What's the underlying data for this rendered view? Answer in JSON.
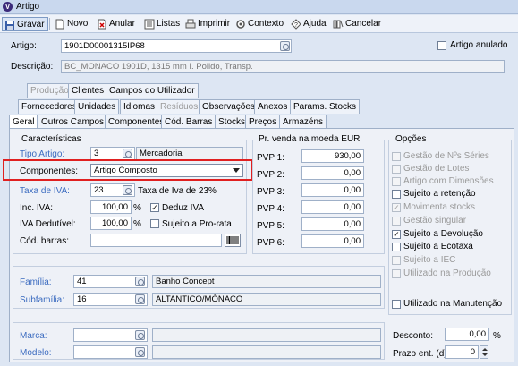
{
  "window": {
    "title": "Artigo"
  },
  "toolbar": {
    "gravar": "Gravar",
    "novo": "Novo",
    "anular": "Anular",
    "listas": "Listas",
    "imprimir": "Imprimir",
    "contexto": "Contexto",
    "ajuda": "Ajuda",
    "cancelar": "Cancelar"
  },
  "header": {
    "artigo_label": "Artigo:",
    "artigo_value": "1901D00001315IP68",
    "anulado_label": "Artigo anulado",
    "descricao_label": "Descrição:",
    "descricao_value": "BC_MONACO 1901D, 1315 mm I. Polido, Transp."
  },
  "tabs_row1": [
    "Produção",
    "Clientes",
    "Campos do Utilizador"
  ],
  "tabs_row2": [
    "Fornecedores",
    "Unidades",
    "Idiomas",
    "Resíduos",
    "Observações",
    "Anexos",
    "Params. Stocks"
  ],
  "tabs_row3": [
    "Geral",
    "Outros Campos",
    "Componentes",
    "Cód. Barras",
    "Stocks",
    "Preços",
    "Armazéns"
  ],
  "caracteristicas": {
    "title": "Características",
    "tipo_label": "Tipo Artigo:",
    "tipo_value": "3",
    "tipo_desc": "Mercadoria",
    "comp_label": "Componentes:",
    "comp_value": "Artigo Composto",
    "iva_label": "Taxa de IVA:",
    "iva_value": "23",
    "iva_desc": "Taxa de Iva de 23%",
    "inc_iva_label": "Inc. IVA:",
    "inc_iva_value": "100,00",
    "pct1": "%",
    "deduz_iva": "Deduz IVA",
    "iva_dedutivel_label": "IVA Dedutível:",
    "iva_dedutivel_value": "100,00",
    "pct2": "%",
    "pro_rata": "Sujeito a Pro-rata",
    "cod_barras_label": "Cód. barras:"
  },
  "precos": {
    "title": "Pr. venda na moeda EUR",
    "rows": [
      {
        "label": "PVP 1:",
        "value": "930,00"
      },
      {
        "label": "PVP 2:",
        "value": "0,00"
      },
      {
        "label": "PVP 3:",
        "value": "0,00"
      },
      {
        "label": "PVP 4:",
        "value": "0,00"
      },
      {
        "label": "PVP 5:",
        "value": "0,00"
      },
      {
        "label": "PVP 6:",
        "value": "0,00"
      }
    ]
  },
  "opcoes": {
    "title": "Opções",
    "items": [
      {
        "label": "Gestão de Nºs Séries",
        "checked": false,
        "enabled": false
      },
      {
        "label": "Gestão de Lotes",
        "checked": false,
        "enabled": false
      },
      {
        "label": "Artigo com Dimensões",
        "checked": false,
        "enabled": false
      },
      {
        "label": "Sujeito a retenção",
        "checked": false,
        "enabled": true
      },
      {
        "label": "Movimenta stocks",
        "checked": true,
        "enabled": false
      },
      {
        "label": "Gestão singular",
        "checked": false,
        "enabled": false
      },
      {
        "label": "Sujeito a Devolução",
        "checked": true,
        "enabled": true
      },
      {
        "label": "Sujeito a Ecotaxa",
        "checked": false,
        "enabled": true
      },
      {
        "label": "Sujeito a IEC",
        "checked": false,
        "enabled": false
      },
      {
        "label": "Utilizado na Produção",
        "checked": false,
        "enabled": false
      }
    ],
    "manutencao": "Utilizado na Manutenção"
  },
  "familia": {
    "familia_label": "Família:",
    "familia_value": "41",
    "familia_desc": "Banho Concept",
    "subfamilia_label": "Subfamília:",
    "subfamilia_value": "16",
    "subfamilia_desc": "ALTANTICO/MÓNACO"
  },
  "marca": {
    "marca_label": "Marca:",
    "modelo_label": "Modelo:"
  },
  "desconto": {
    "label": "Desconto:",
    "value": "0,00",
    "pct": "%",
    "prazo_label": "Prazo ent. (d):",
    "prazo_value": "0"
  },
  "colors": {
    "accent": "#3c6cc0",
    "highlight": "#e02020"
  }
}
